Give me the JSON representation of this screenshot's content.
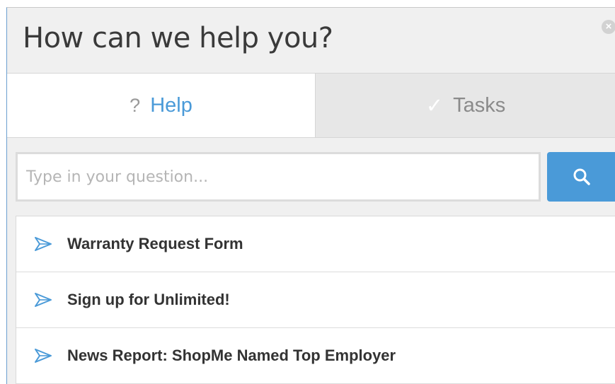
{
  "header": {
    "title": "How can we help you?",
    "close_icon": "close-circle-icon"
  },
  "tabs": [
    {
      "label": "Help",
      "icon": "question-mark-icon",
      "glyph": "?",
      "active": true
    },
    {
      "label": "Tasks",
      "icon": "checkmark-icon",
      "glyph": "✓",
      "active": false
    }
  ],
  "search": {
    "placeholder": "Type in your question...",
    "value": "",
    "button_icon": "magnifier-icon"
  },
  "results": [
    {
      "label": "Warranty Request Form",
      "icon": "paper-plane-icon"
    },
    {
      "label": "Sign up for Unlimited!",
      "icon": "paper-plane-icon"
    },
    {
      "label": "News Report: ShopMe Named Top Employer",
      "icon": "paper-plane-icon"
    }
  ],
  "colors": {
    "accent": "#4a9ad8",
    "header_bg": "#f0f0f0",
    "inactive_tab_bg": "#e7e7e7",
    "title_text": "#3a3a3a",
    "item_text": "#333333"
  }
}
